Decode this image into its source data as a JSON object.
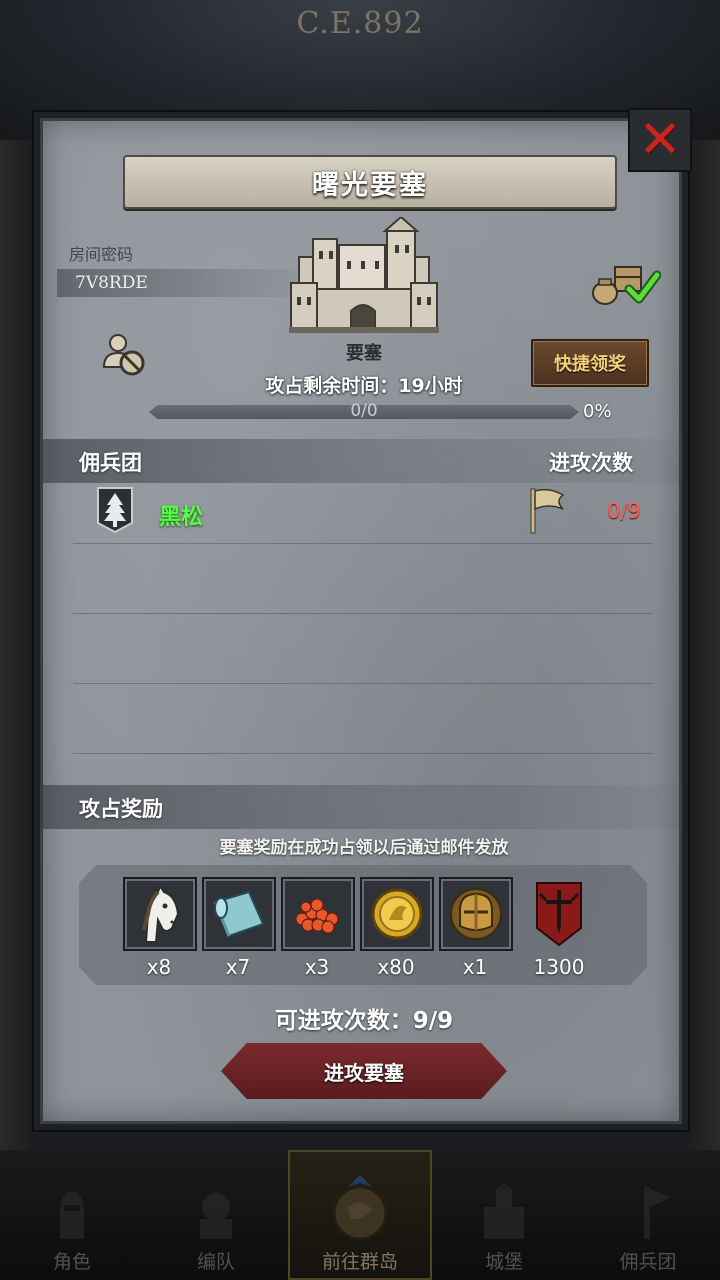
{
  "header": {
    "year": "C.E.892"
  },
  "dialog": {
    "title": "曙光要塞",
    "room_label": "房间密码",
    "room_code": "7V8RDE",
    "building_label": "要塞",
    "quick_claim": "快捷领奖",
    "remaining_time": "攻占剩余时间：19小时",
    "progress_text": "0/0",
    "progress_percent": "0%",
    "progress_fraction": 0,
    "mercenary_header": "佣兵团",
    "attack_count_header": "进攻次数",
    "guilds": [
      {
        "name": "黑松",
        "attacks": "0/9"
      }
    ],
    "rewards_header": "攻占奖励",
    "reward_note": "要塞奖励在成功占领以后通过邮件发放",
    "rewards": [
      {
        "icon": "horse-icon",
        "qty": "x8"
      },
      {
        "icon": "cloth-icon",
        "qty": "x7"
      },
      {
        "icon": "berries-icon",
        "qty": "x3"
      },
      {
        "icon": "gold-coin-icon",
        "qty": "x80"
      },
      {
        "icon": "helmet-icon",
        "qty": "x1"
      },
      {
        "icon": "banner-icon",
        "qty": "1300"
      }
    ],
    "attacks_left": "可进攻次数：9/9",
    "attack_button": "进攻要塞"
  },
  "nav": [
    {
      "label": "角色",
      "icon": "knight-icon"
    },
    {
      "label": "编队",
      "icon": "formation-icon"
    },
    {
      "label": "前往群岛",
      "icon": "map-icon",
      "active": true
    },
    {
      "label": "城堡",
      "icon": "castle-icon"
    },
    {
      "label": "佣兵团",
      "icon": "mercenary-icon"
    }
  ],
  "colors": {
    "guild_name": "#55ff44",
    "attack_count": "#ff5b4f",
    "close": "#c8261d",
    "quick_claim_text": "#f6cf7c"
  }
}
